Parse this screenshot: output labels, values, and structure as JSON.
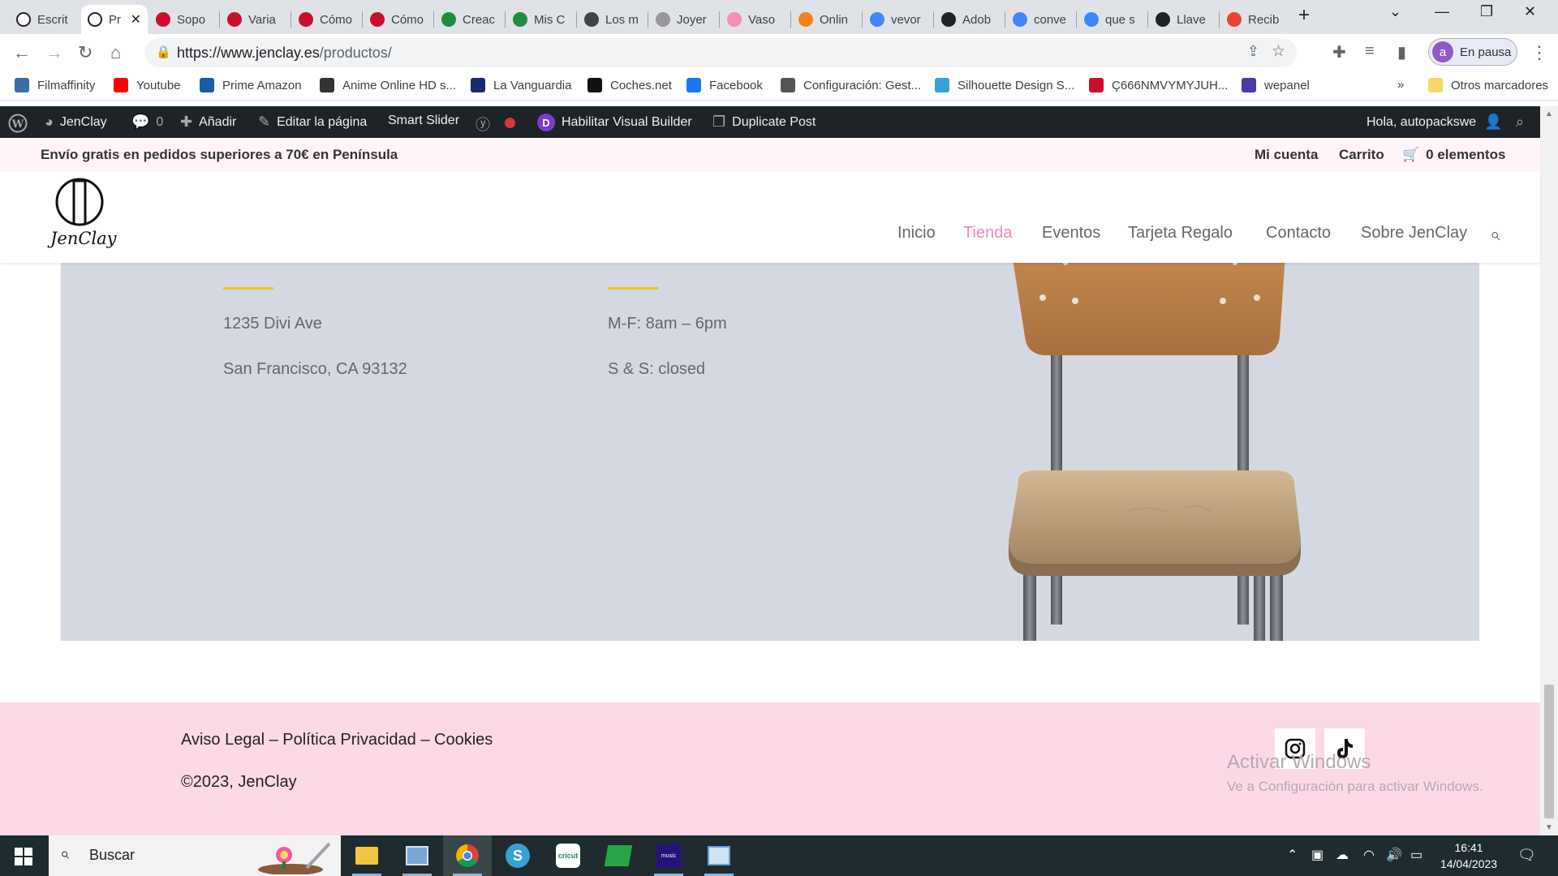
{
  "browser": {
    "tabs": [
      {
        "label": "Escrit",
        "icon": "jenclay-favicon",
        "color": "#ffffff"
      },
      {
        "label": "Pr",
        "icon": "jenclay-favicon",
        "color": "#ffffff",
        "active": true
      },
      {
        "label": "Sopo",
        "icon": "w-red-icon",
        "color": "#c8102e"
      },
      {
        "label": "Varia",
        "icon": "w-red-icon",
        "color": "#c8102e"
      },
      {
        "label": "Cómo",
        "icon": "w-red-icon",
        "color": "#c8102e"
      },
      {
        "label": "Cómo",
        "icon": "w-red-icon",
        "color": "#c8102e"
      },
      {
        "label": "Creac",
        "icon": "w-green-icon",
        "color": "#1e8e3e"
      },
      {
        "label": "Mis C",
        "icon": "w-green-icon",
        "color": "#1e8e3e"
      },
      {
        "label": "Los m",
        "icon": "gn-icon",
        "color": "#444444"
      },
      {
        "label": "Joyer",
        "icon": "signature-icon",
        "color": "#999999"
      },
      {
        "label": "Vaso",
        "icon": "heart-icon",
        "color": "#f48fb1"
      },
      {
        "label": "Onlin",
        "icon": "convert-icon",
        "color": "#f4801f"
      },
      {
        "label": "vevor",
        "icon": "google-icon",
        "color": "#4285f4"
      },
      {
        "label": "Adob",
        "icon": "adobe-icon",
        "color": "#222222"
      },
      {
        "label": "conve",
        "icon": "google-icon",
        "color": "#4285f4"
      },
      {
        "label": "que s",
        "icon": "google-icon",
        "color": "#4285f4"
      },
      {
        "label": "Llave",
        "icon": "globe-dark-icon",
        "color": "#222222"
      },
      {
        "label": "Recib",
        "icon": "gmail-icon",
        "color": "#ea4335"
      }
    ],
    "url_host": "https://www.jenclay.es",
    "url_path": "/productos/",
    "profile_initial": "a",
    "profile_status": "En pausa",
    "bookmarks": [
      {
        "label": "Filmaffinity",
        "icon": "filmaffinity-icon",
        "color": "#3b6ea5"
      },
      {
        "label": "Youtube",
        "icon": "youtube-icon",
        "color": "#ff0000"
      },
      {
        "label": "Prime Amazon",
        "icon": "prime-icon",
        "color": "#1a5ea8"
      },
      {
        "label": "Anime Online HD s...",
        "icon": "af-icon",
        "color": "#333333"
      },
      {
        "label": "La Vanguardia",
        "icon": "v-icon",
        "color": "#1a2a6c"
      },
      {
        "label": "Coches.net",
        "icon": "c-icon",
        "color": "#111111"
      },
      {
        "label": "Facebook",
        "icon": "facebook-icon",
        "color": "#1877f2"
      },
      {
        "label": "Configuración: Gest...",
        "icon": "gear-icon",
        "color": "#555555"
      },
      {
        "label": "Silhouette Design S...",
        "icon": "silhouette-icon",
        "color": "#3aa0d8"
      },
      {
        "label": "Ç666NMVYMYJUH...",
        "icon": "bookmark-red-icon",
        "color": "#c8102e"
      },
      {
        "label": "wepanel",
        "icon": "wepanel-icon",
        "color": "#4b3aa8"
      }
    ],
    "bookmarks_more": "»",
    "other_bookmarks": "Otros marcadores"
  },
  "adminbar": {
    "site": "JenClay",
    "comments": "0",
    "add": "Añadir",
    "edit": "Editar la página",
    "slider": "Smart Slider",
    "visual_builder": "Habilitar Visual Builder",
    "duplicate": "Duplicate Post",
    "greeting": "Hola, autopackswe",
    "status_color": "#d63638"
  },
  "promo": {
    "shipping": "Envío gratis en pedidos superiores a 70€ en Península",
    "account": "Mi cuenta",
    "cart": "Carrito",
    "items": "0 elementos"
  },
  "site": {
    "logo_text": "JenClay",
    "menu": [
      "Inicio",
      "Tienda",
      "Eventos",
      "Tarjeta Regalo",
      "Contacto",
      "Sobre JenClay"
    ],
    "active_menu": "Tienda",
    "accent_color": "#f08ac4"
  },
  "content": {
    "address1": "1235 Divi Ave",
    "address2": "San Francisco, CA 93132",
    "hours1": "M-F: 8am – 6pm",
    "hours2": "S & S: closed"
  },
  "footer": {
    "links": "Aviso Legal – Política Privacidad – Cookies",
    "copyright": "©2023,  JenClay",
    "watermark_title": "Activar Windows",
    "watermark_sub": "Ve a Configuración para activar Windows."
  },
  "taskbar": {
    "search": "Buscar",
    "time": "16:41",
    "date": "14/04/2023"
  }
}
